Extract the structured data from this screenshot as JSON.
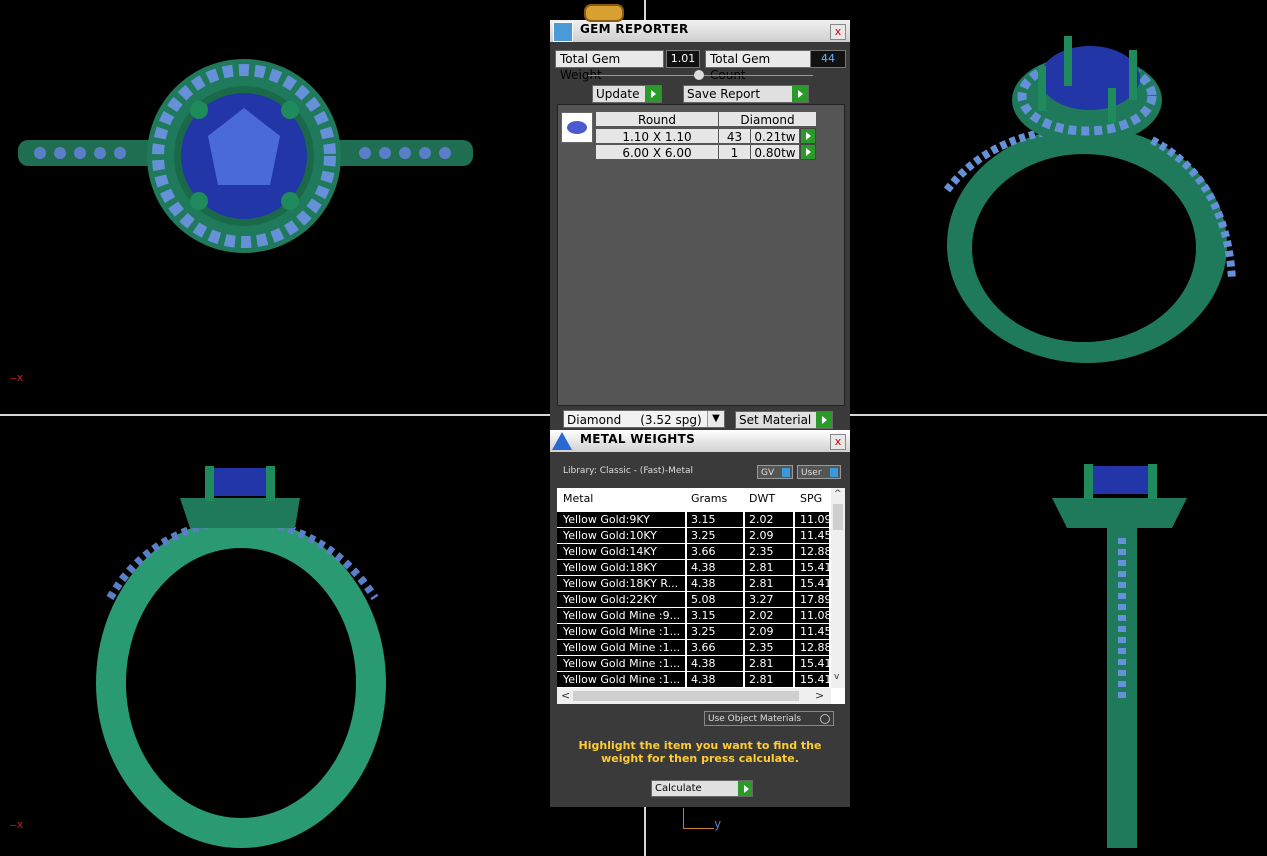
{
  "axes": {
    "x_label": "x",
    "y_label": "y"
  },
  "gem_reporter": {
    "title": "GEM REPORTER",
    "close": "x",
    "total_weight_label": "Total Gem Weight",
    "total_weight_value": "1.01",
    "total_count_label": "Total Gem Count",
    "total_count_value": "44",
    "update_label": "Update",
    "save_report_label": "Save Report",
    "table_headers": {
      "shape": "Round",
      "material": "Diamond"
    },
    "rows": [
      {
        "size": "1.10 X 1.10",
        "count": "43",
        "weight": "0.21tw"
      },
      {
        "size": "6.00 X 6.00",
        "count": "1",
        "weight": "0.80tw"
      }
    ],
    "material_select": "Diamond     (3.52 spg)",
    "set_material_label": "Set Material"
  },
  "metal_weights": {
    "title": "METAL WEIGHTS",
    "close": "x",
    "library": "Library: Classic - (Fast)-Metal",
    "gv_label": "GV",
    "user_label": "User",
    "columns": [
      "Metal",
      "Grams",
      "DWT",
      "SPG"
    ],
    "rows": [
      [
        "Yellow Gold:9KY",
        "3.15",
        "2.02",
        "11.09"
      ],
      [
        "Yellow Gold:10KY",
        "3.25",
        "2.09",
        "11.45"
      ],
      [
        "Yellow Gold:14KY",
        "3.66",
        "2.35",
        "12.88"
      ],
      [
        "Yellow Gold:18KY",
        "4.38",
        "2.81",
        "15.41"
      ],
      [
        "Yellow Gold:18KY R...",
        "4.38",
        "2.81",
        "15.41"
      ],
      [
        "Yellow Gold:22KY",
        "5.08",
        "3.27",
        "17.89"
      ],
      [
        "Yellow Gold Mine :9...",
        "3.15",
        "2.02",
        "11.08"
      ],
      [
        "Yellow Gold Mine :1...",
        "3.25",
        "2.09",
        "11.45"
      ],
      [
        "Yellow Gold Mine :1...",
        "3.66",
        "2.35",
        "12.88"
      ],
      [
        "Yellow Gold Mine :1...",
        "4.38",
        "2.81",
        "15.41"
      ],
      [
        "Yellow Gold Mine :1...",
        "4.38",
        "2.81",
        "15.41"
      ]
    ],
    "use_object_materials": "Use Object Materials",
    "hint": "Highlight the item you want to find the weight for then press calculate.",
    "calculate_label": "Calculate"
  },
  "colors": {
    "ring_green": "#1f7a5c",
    "gem_blue": "#2a3fb0",
    "hint_yellow": "#ffcc33"
  }
}
